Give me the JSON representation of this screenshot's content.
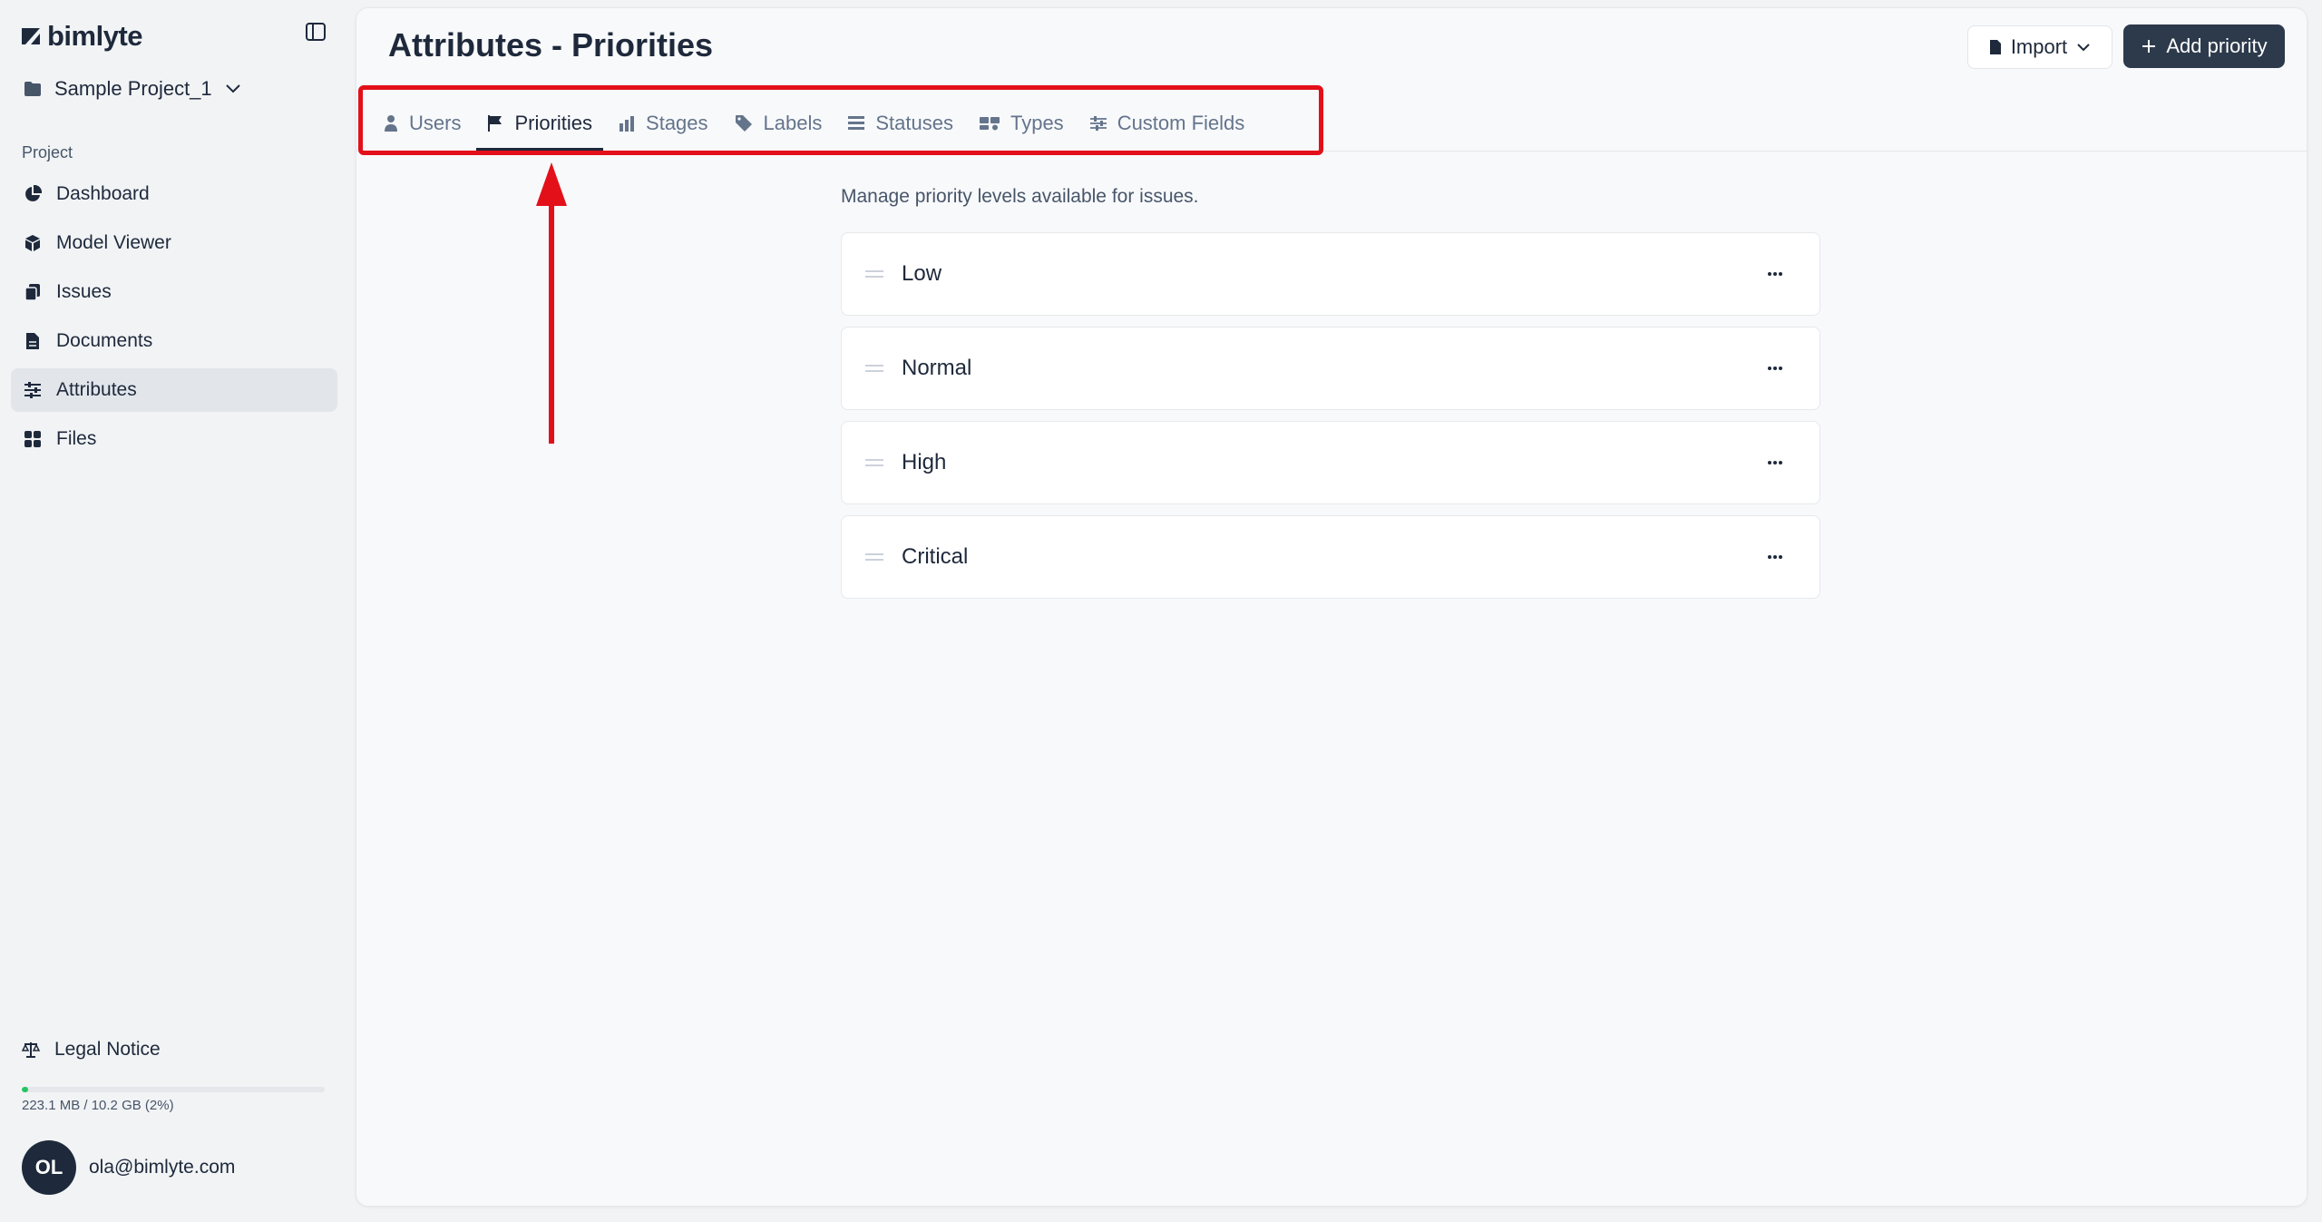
{
  "brand": {
    "name": "bimlyte"
  },
  "project": {
    "name": "Sample Project_1"
  },
  "sidebar": {
    "section_label": "Project",
    "items": [
      {
        "label": "Dashboard",
        "icon": "pie-chart-icon"
      },
      {
        "label": "Model Viewer",
        "icon": "cube-icon"
      },
      {
        "label": "Issues",
        "icon": "clipboard-icon"
      },
      {
        "label": "Documents",
        "icon": "document-icon"
      },
      {
        "label": "Attributes",
        "icon": "sliders-icon",
        "active": true
      },
      {
        "label": "Files",
        "icon": "grid-icon"
      }
    ],
    "legal_label": "Legal Notice",
    "storage": {
      "text": "223.1 MB / 10.2 GB (2%)",
      "percent": 2
    },
    "user": {
      "initials": "OL",
      "email": "ola@bimlyte.com"
    }
  },
  "header": {
    "title": "Attributes - Priorities",
    "import_label": "Import",
    "add_label": "Add priority"
  },
  "tabs": [
    {
      "label": "Users",
      "icon": "user-icon"
    },
    {
      "label": "Priorities",
      "icon": "flag-icon",
      "active": true
    },
    {
      "label": "Stages",
      "icon": "bar-chart-icon"
    },
    {
      "label": "Labels",
      "icon": "tag-icon"
    },
    {
      "label": "Statuses",
      "icon": "list-icon"
    },
    {
      "label": "Types",
      "icon": "shapes-icon"
    },
    {
      "label": "Custom Fields",
      "icon": "sliders-icon"
    }
  ],
  "content": {
    "description": "Manage priority levels available for issues.",
    "priorities": [
      "Low",
      "Normal",
      "High",
      "Critical"
    ]
  },
  "colors": {
    "accent": "#2d3a4c",
    "annotation": "#e3101a",
    "storage": "#22c55e"
  }
}
